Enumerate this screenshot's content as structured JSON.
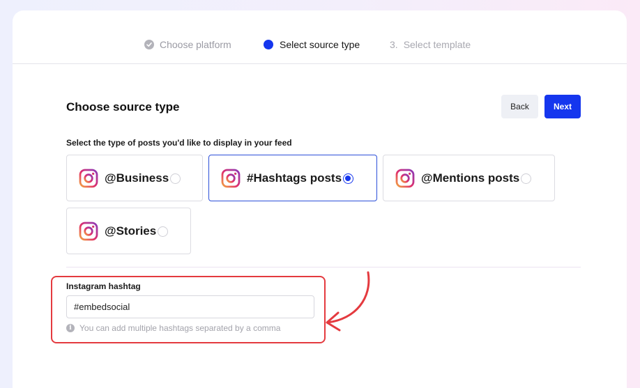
{
  "stepper": {
    "steps": [
      {
        "number": "",
        "label": "Choose platform",
        "state": "done",
        "icon": "check-circle-icon"
      },
      {
        "number": "",
        "label": "Select source type",
        "state": "active",
        "icon": "active-dot-icon"
      },
      {
        "number": "3.",
        "label": "Select template",
        "state": "upcoming"
      }
    ]
  },
  "header": {
    "title": "Choose source type",
    "back_label": "Back",
    "next_label": "Next"
  },
  "source_types": {
    "prompt": "Select the type of posts you'd like to display in your feed",
    "options": [
      {
        "label": "@Business",
        "icon": "instagram-icon",
        "selected": false
      },
      {
        "label": "#Hashtags posts",
        "icon": "instagram-icon",
        "selected": true
      },
      {
        "label": "@Mentions posts",
        "icon": "instagram-icon",
        "selected": false
      },
      {
        "label": "@Stories",
        "icon": "instagram-icon",
        "selected": false
      }
    ]
  },
  "hashtag_field": {
    "label": "Instagram hashtag",
    "value": "#embedsocial",
    "hint": "You can add multiple hashtags separated by a comma",
    "hint_icon": "info-icon"
  },
  "colors": {
    "accent": "#1536ee",
    "highlight": "#e43a3f",
    "muted_text": "#a3a3ab"
  }
}
